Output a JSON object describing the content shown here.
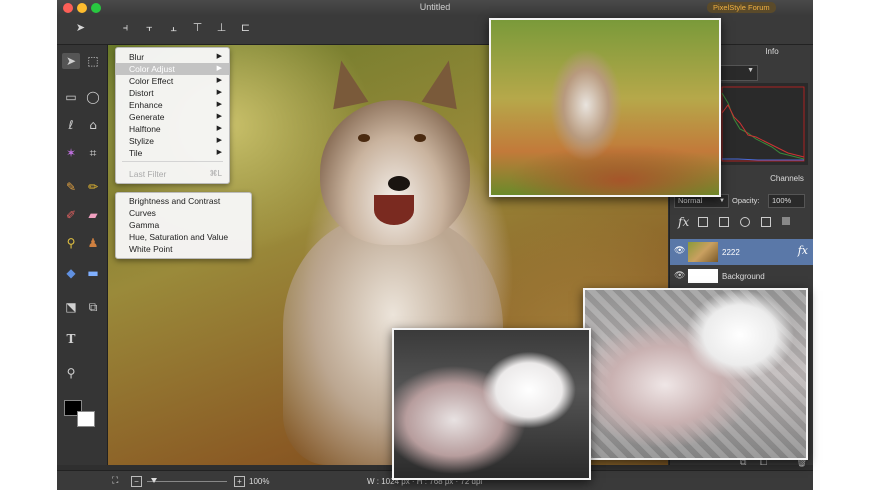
{
  "window": {
    "title": "Untitled",
    "badge": "PixelStyle Forum"
  },
  "colors": {
    "window_bg": "#2f2f2f",
    "menu_bg": "#f6f6f6",
    "selected_menu": "#c3c3c3",
    "active_layer": "#5a78a8",
    "forum_badge": "#f0b040"
  },
  "toolbar": {
    "icons": [
      "move-tool-icon",
      "align-left-icon",
      "align-center-icon",
      "align-right-icon",
      "align-top-icon",
      "align-middle-icon",
      "align-bottom-icon"
    ]
  },
  "tools": {
    "icons": [
      "move-icon",
      "select-icon",
      "rect-marquee-icon",
      "ellipse-marquee-icon",
      "lasso-icon",
      "poly-lasso-icon",
      "magic-wand-icon",
      "crop-icon",
      "brush-icon",
      "pencil-icon",
      "eraser-icon",
      "smudge-icon",
      "eyedropper-icon",
      "stamp-icon",
      "bucket-icon",
      "gradient-icon",
      "transform-icon",
      "shape-icon",
      "text-icon",
      "zoom-icon"
    ]
  },
  "filter_menu": {
    "items": [
      {
        "label": "Blur",
        "has_submenu": true
      },
      {
        "label": "Color Adjust",
        "has_submenu": true,
        "selected": true
      },
      {
        "label": "Color Effect",
        "has_submenu": true
      },
      {
        "label": "Distort",
        "has_submenu": true
      },
      {
        "label": "Enhance",
        "has_submenu": true
      },
      {
        "label": "Generate",
        "has_submenu": true
      },
      {
        "label": "Halftone",
        "has_submenu": true
      },
      {
        "label": "Stylize",
        "has_submenu": true
      },
      {
        "label": "Tile",
        "has_submenu": true
      }
    ],
    "last_filter": "Last Filter",
    "last_filter_shortcut": "⌘L"
  },
  "color_adjust_submenu": {
    "items": [
      "Brightness and Contrast",
      "Curves",
      "Gamma",
      "Hue, Saturation and Value",
      "White Point"
    ]
  },
  "right_panel": {
    "info_title": "Info",
    "channels_title": "Channels",
    "blend_mode": "Normal",
    "opacity_label": "Opacity:",
    "opacity_value": "100%",
    "fx_label": "fx",
    "layers": [
      {
        "name": "2222",
        "active": true
      },
      {
        "name": "Background",
        "active": false
      }
    ]
  },
  "statusbar": {
    "zoom": "100%",
    "dims": "W : 1024 px  ·  H : 768 px  ·  72 dpi"
  }
}
